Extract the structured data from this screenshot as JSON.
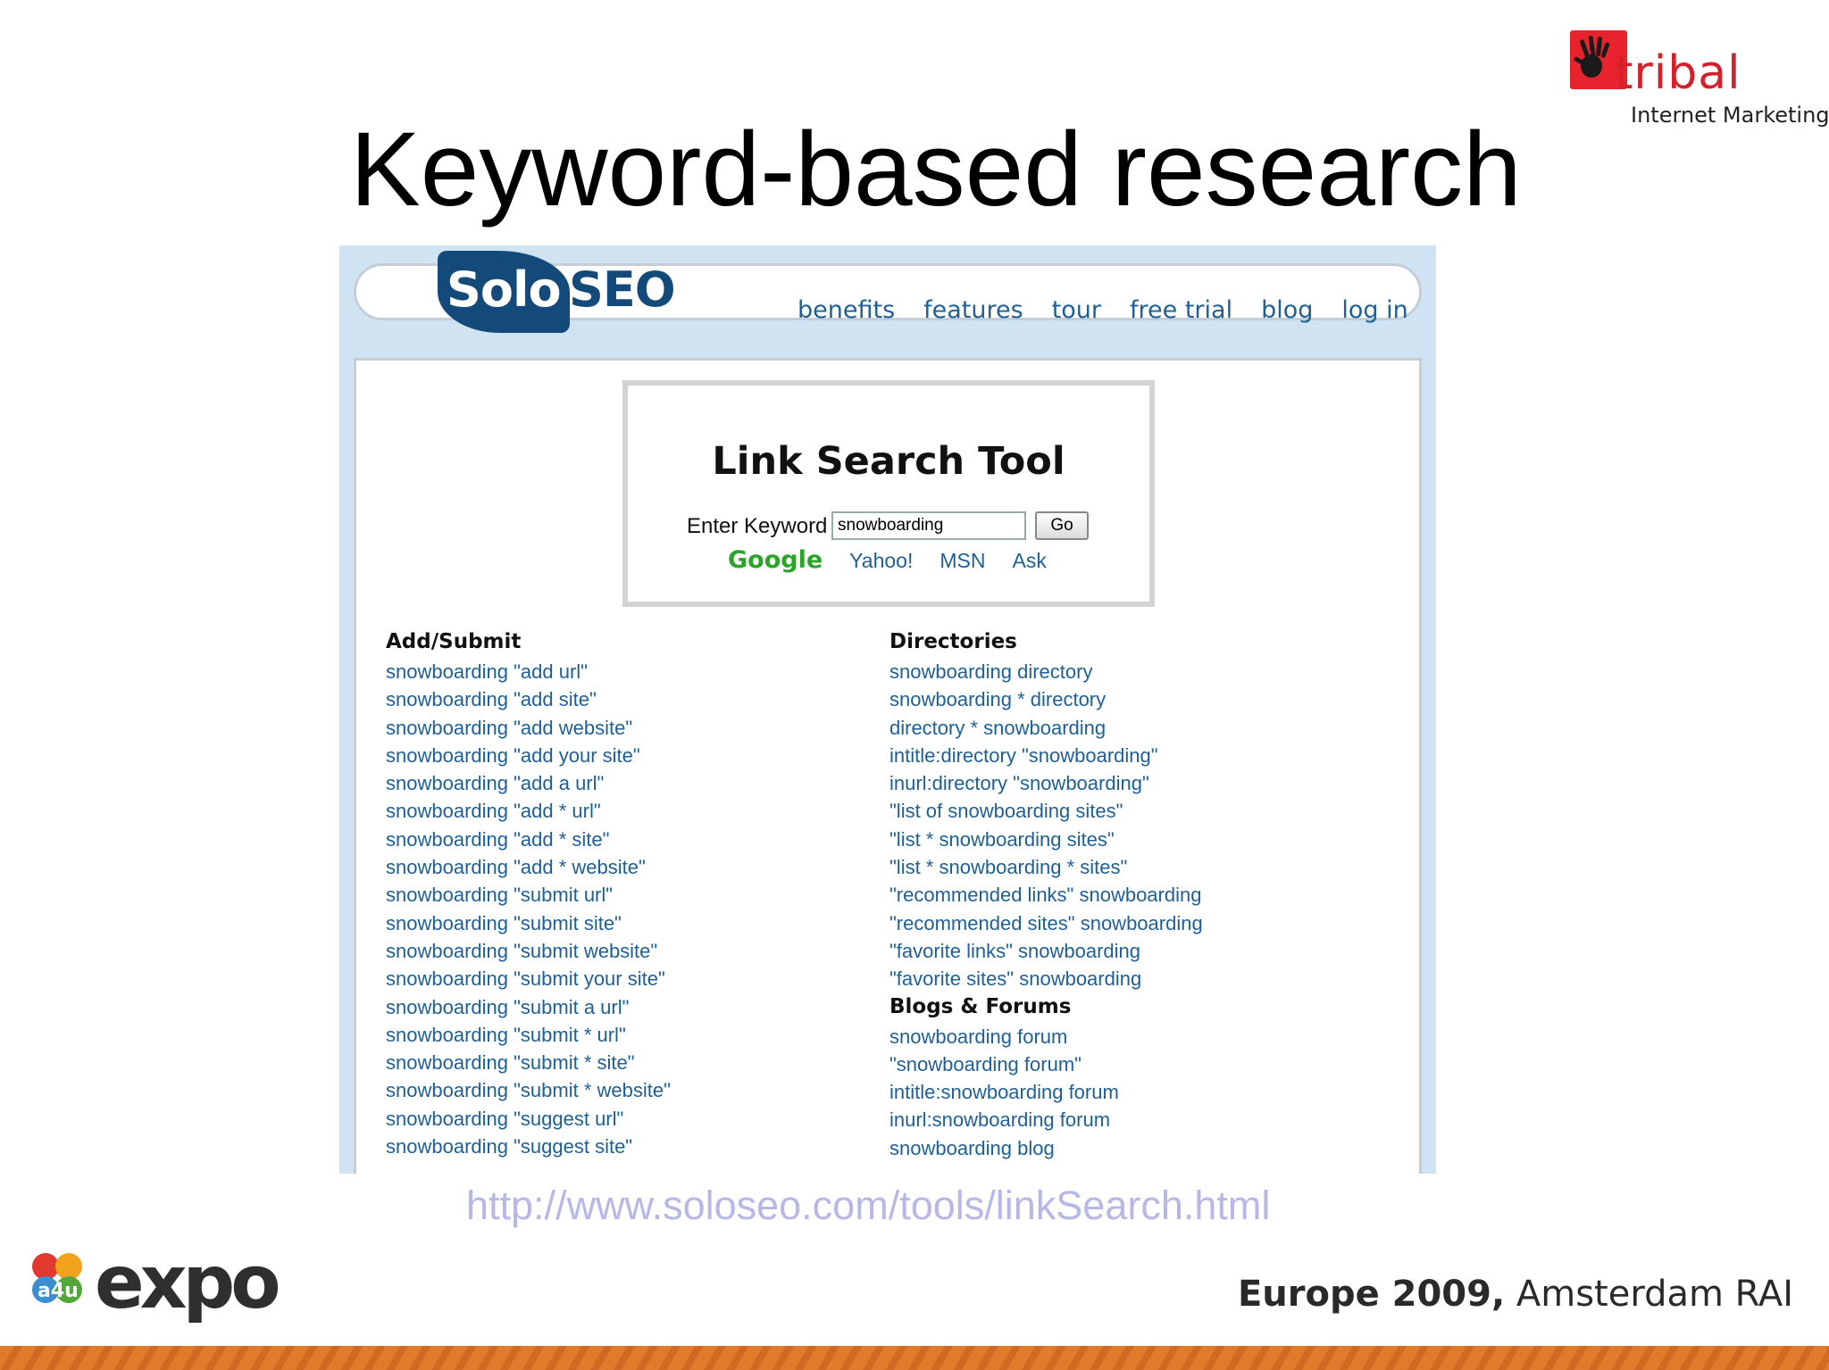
{
  "slide": {
    "title": "Keyword-based research",
    "source_url": "http://www.soloseo.com/tools/linkSearch.html"
  },
  "brand": {
    "tribal_word": "tribal",
    "tribal_sub": "Internet Marketing",
    "expo_word": "expo",
    "expo_badge": "a4u"
  },
  "event": {
    "bold": "Europe 2009,",
    "rest": " Amsterdam RAI"
  },
  "site": {
    "logo_solo": "Solo",
    "logo_seo": "SEO",
    "nav": [
      "benefits",
      "features",
      "tour",
      "free trial",
      "blog",
      "log in"
    ]
  },
  "tool": {
    "title": "Link Search Tool",
    "keyword_label": "Enter Keyword",
    "keyword_value": "snowboarding",
    "go_label": "Go",
    "engines": [
      "Google",
      "Yahoo!",
      "MSN",
      "Ask"
    ],
    "active_engine": "Google"
  },
  "sections": {
    "add_submit": {
      "heading": "Add/Submit",
      "items": [
        "snowboarding \"add url\"",
        "snowboarding \"add site\"",
        "snowboarding \"add website\"",
        "snowboarding \"add your site\"",
        "snowboarding \"add a url\"",
        "snowboarding \"add * url\"",
        "snowboarding \"add * site\"",
        "snowboarding \"add * website\"",
        "snowboarding \"submit url\"",
        "snowboarding \"submit site\"",
        "snowboarding \"submit website\"",
        "snowboarding \"submit your site\"",
        "snowboarding \"submit a url\"",
        "snowboarding \"submit * url\"",
        "snowboarding \"submit * site\"",
        "snowboarding \"submit * website\"",
        "snowboarding \"suggest url\"",
        "snowboarding \"suggest site\""
      ]
    },
    "directories": {
      "heading": "Directories",
      "items": [
        "snowboarding directory",
        "snowboarding * directory",
        "directory * snowboarding",
        "intitle:directory \"snowboarding\"",
        "inurl:directory \"snowboarding\"",
        "\"list of snowboarding sites\"",
        "\"list * snowboarding sites\"",
        "\"list * snowboarding * sites\"",
        "\"recommended links\" snowboarding",
        "\"recommended sites\" snowboarding",
        "\"favorite links\" snowboarding",
        "\"favorite sites\" snowboarding"
      ]
    },
    "blogs_forums": {
      "heading": "Blogs & Forums",
      "items": [
        "snowboarding forum",
        "\"snowboarding forum\"",
        "intitle:snowboarding forum",
        "inurl:snowboarding forum",
        "snowboarding blog"
      ]
    }
  },
  "colors": {
    "link": "#1e5f96",
    "google_active": "#2aa52a",
    "frame_bg": "#cfe3f3",
    "logo_navy": "#134a79",
    "tribal_red": "#e8232d",
    "footer_orange": "#e07b2b"
  },
  "icons": {
    "tribal_mark": "hand-print-icon",
    "expo_mark": "colored-dots-icon"
  }
}
